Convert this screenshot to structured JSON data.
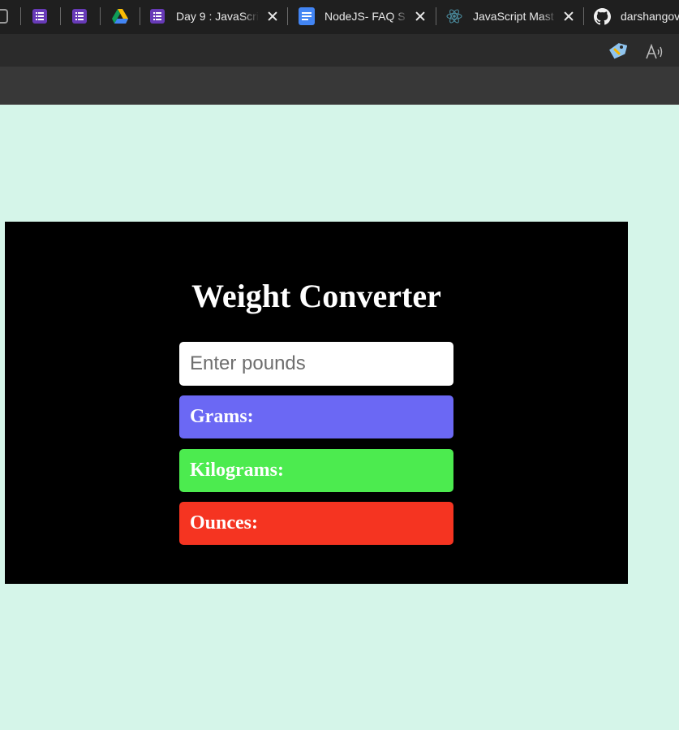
{
  "browser": {
    "tabs": [
      {
        "title": "Day 9 : JavaScri",
        "icon": "google-forms-icon"
      },
      {
        "title": "NodeJS- FAQ S",
        "icon": "google-docs-icon"
      },
      {
        "title": "JavaScript Mast",
        "icon": "react-icon"
      },
      {
        "title": "darshangov",
        "icon": "github-icon"
      }
    ]
  },
  "converter": {
    "title": "Weight Converter",
    "input_placeholder": "Enter pounds",
    "input_value": "",
    "grams_label": "Grams:",
    "grams_value": "",
    "kilograms_label": "Kilograms:",
    "kilograms_value": "",
    "ounces_label": "Ounces:",
    "ounces_value": ""
  },
  "colors": {
    "page_background": "#d5f5e9",
    "card_background": "#000000",
    "grams": "#6b68f4",
    "kilograms": "#4ceb4f",
    "ounces": "#f53421"
  }
}
